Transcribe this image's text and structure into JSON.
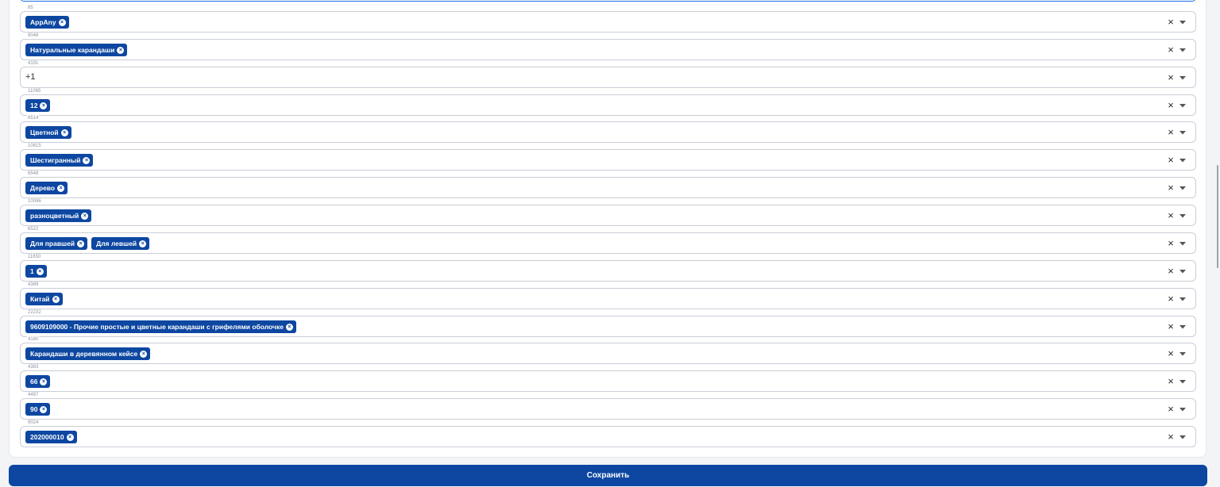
{
  "fields": [
    {
      "label": "85",
      "chips": [
        "AppAny"
      ]
    },
    {
      "label": "9048",
      "chips": [
        "Натуральные карандаши"
      ]
    },
    {
      "label": "4191",
      "chips": [],
      "extra": "+1"
    },
    {
      "label": "11065",
      "chips": [
        "12"
      ]
    },
    {
      "label": "6514",
      "chips": [
        "Цветной"
      ]
    },
    {
      "label": "10815",
      "chips": [
        "Шестигранный"
      ]
    },
    {
      "label": "6548",
      "chips": [
        "Дерево"
      ]
    },
    {
      "label": "10096",
      "chips": [
        "разноцветный"
      ]
    },
    {
      "label": "6522",
      "chips": [
        "Для правшей",
        "Для левшей"
      ]
    },
    {
      "label": "11650",
      "chips": [
        "1"
      ]
    },
    {
      "label": "4389",
      "chips": [
        "Китай"
      ]
    },
    {
      "label": "22232",
      "chips": [
        "9609109000 - Прочие простые и цветные карандаши с грифелями оболочке"
      ]
    },
    {
      "label": "4180",
      "chips": [
        "Карандаши в деревянном кейсе"
      ]
    },
    {
      "label": "4383",
      "chips": [
        "66"
      ]
    },
    {
      "label": "4497",
      "chips": [
        "90"
      ]
    },
    {
      "label": "9024",
      "chips": [
        "202000010"
      ]
    }
  ],
  "icons": {
    "clear": "×",
    "chip_remove": "×"
  },
  "save_label": "Сохранить",
  "colors": {
    "accent": "#0d47a1",
    "border": "#c9ced6"
  }
}
